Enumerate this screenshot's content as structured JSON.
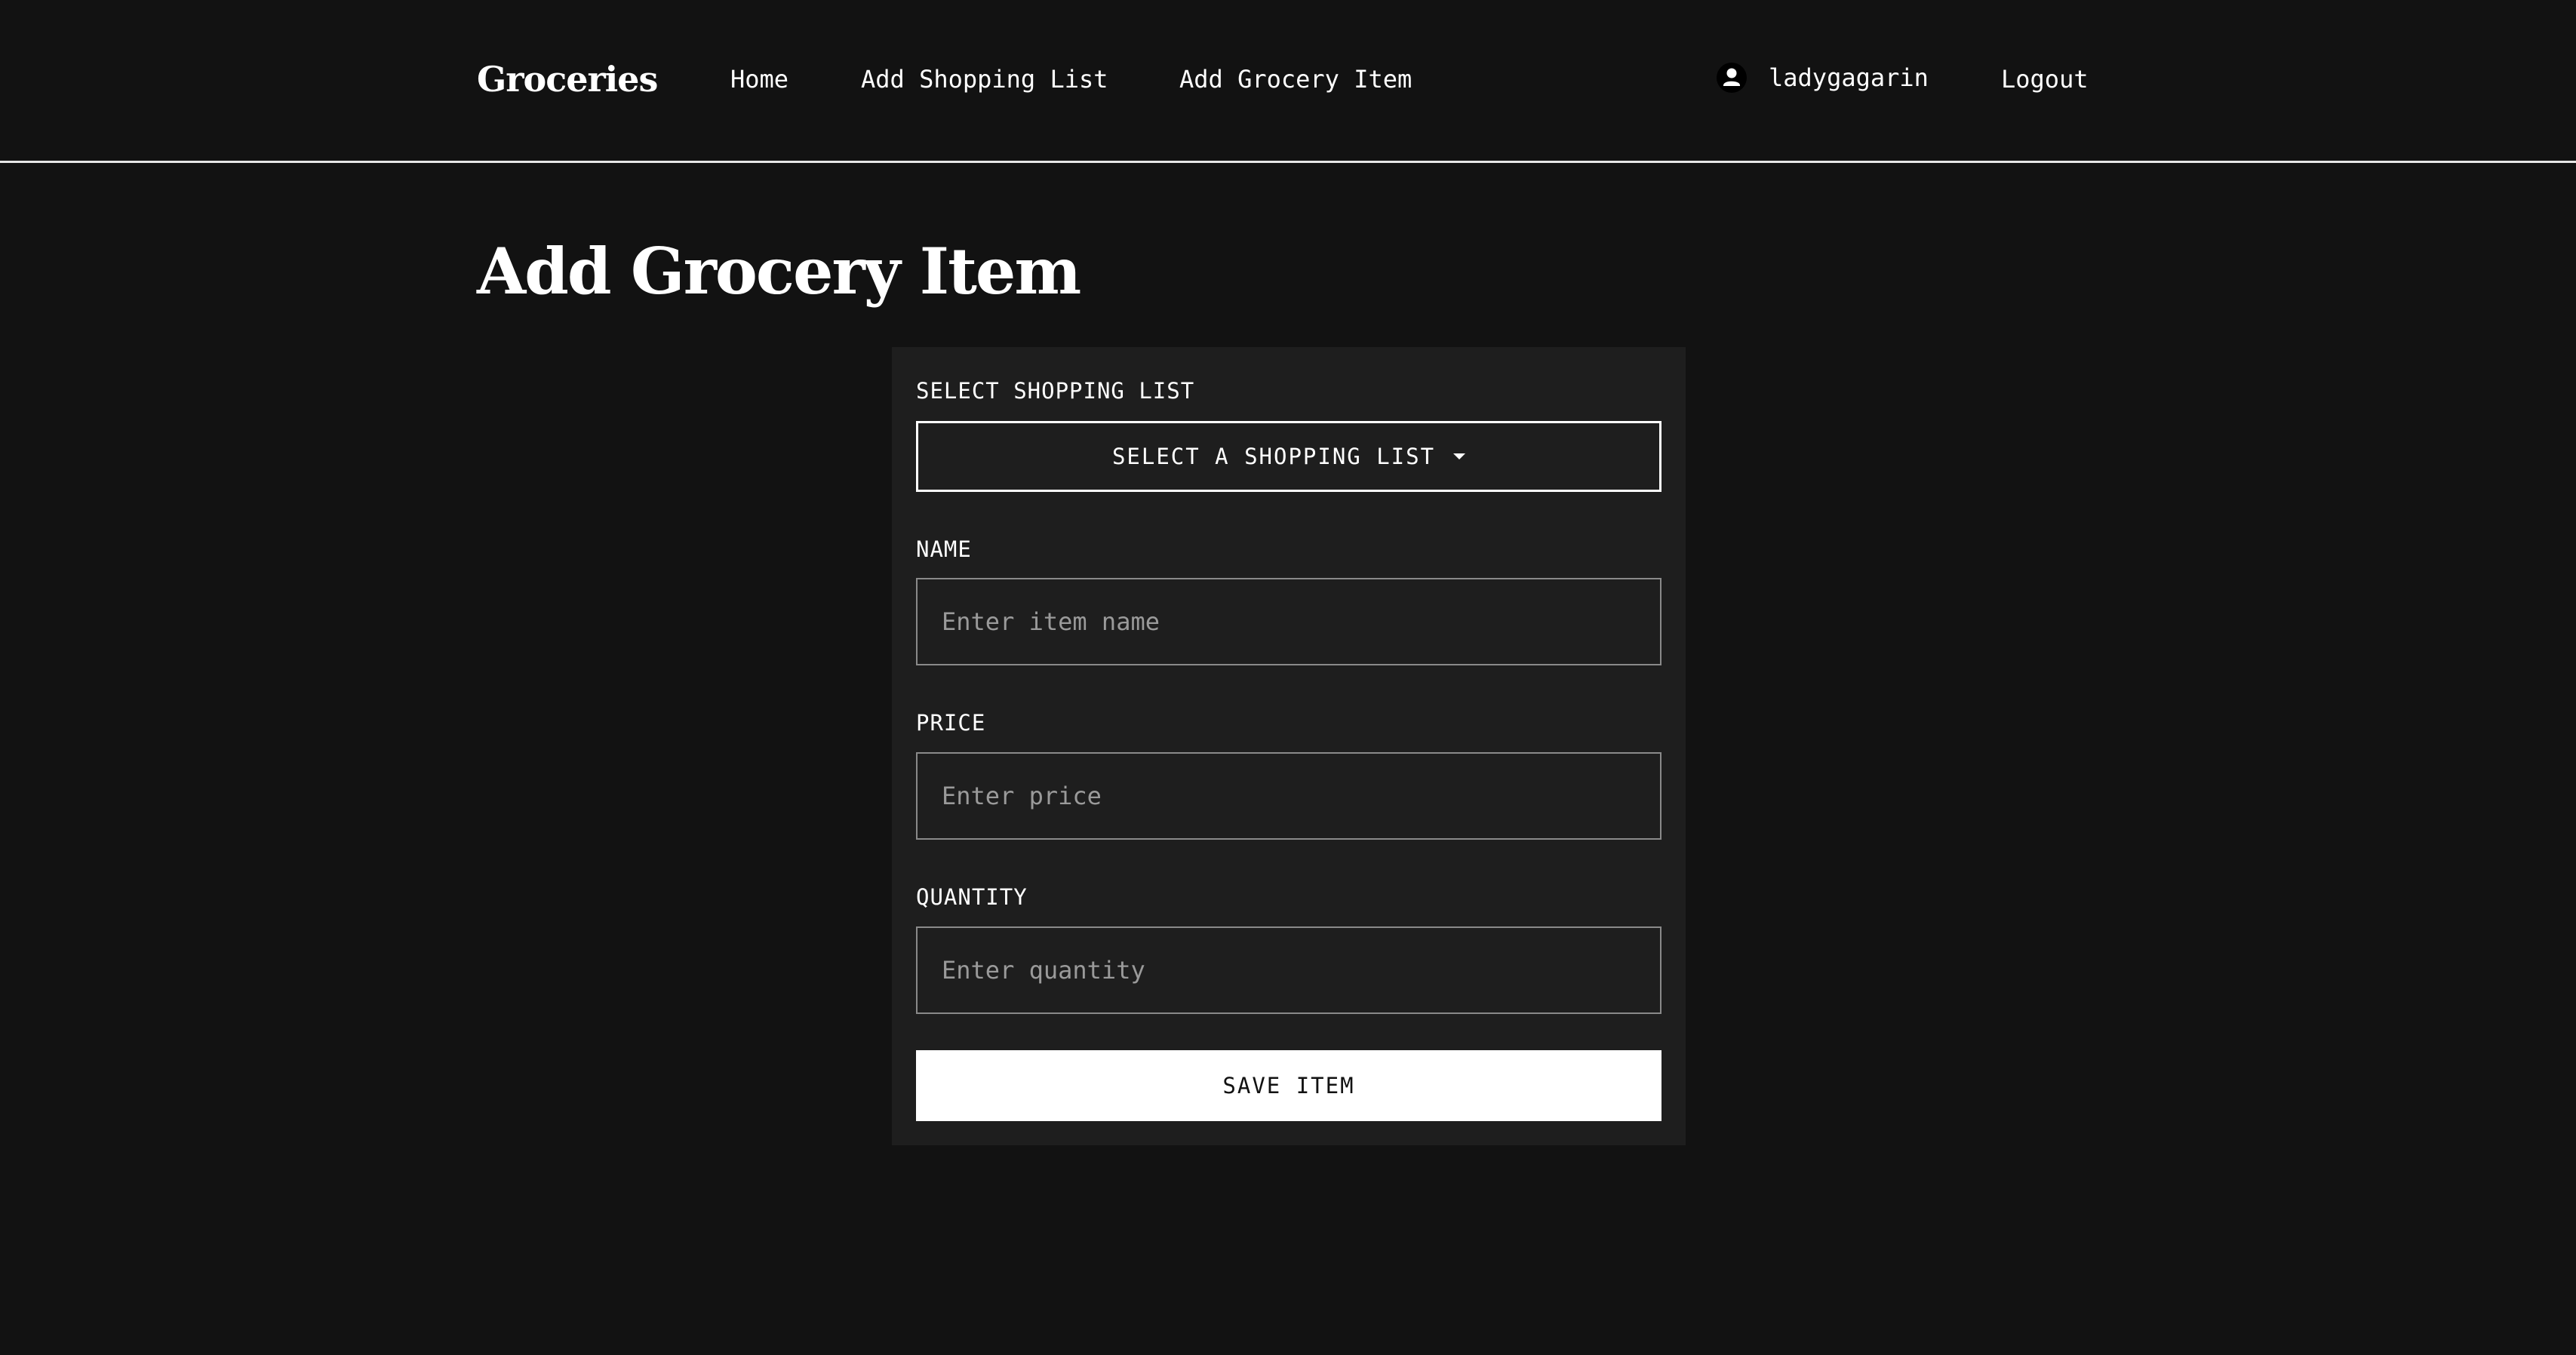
{
  "navbar": {
    "brand": "Groceries",
    "links": {
      "home": "Home",
      "add_shopping_list": "Add Shopping List",
      "add_grocery_item": "Add Grocery Item",
      "logout": "Logout"
    },
    "user": {
      "icon": "user-icon",
      "username": "ladygagarin"
    }
  },
  "page": {
    "title": "Add Grocery Item"
  },
  "form": {
    "shopping_list": {
      "label": "SELECT SHOPPING LIST",
      "button_label": "SELECT A SHOPPING LIST",
      "icon": "caret-down-icon"
    },
    "name": {
      "label": "NAME",
      "value": "",
      "placeholder": "Enter item name"
    },
    "price": {
      "label": "PRICE",
      "value": "",
      "placeholder": "Enter price"
    },
    "quantity": {
      "label": "QUANTITY",
      "value": "",
      "placeholder": "Enter quantity"
    },
    "save_label": "SAVE ITEM"
  },
  "colors": {
    "background": "#121212",
    "card": "#1e1e1e",
    "text": "#ffffff",
    "input_border": "#8a8a8a",
    "placeholder": "#9a9a9a",
    "button_bg": "#ffffff",
    "button_text": "#121212"
  }
}
